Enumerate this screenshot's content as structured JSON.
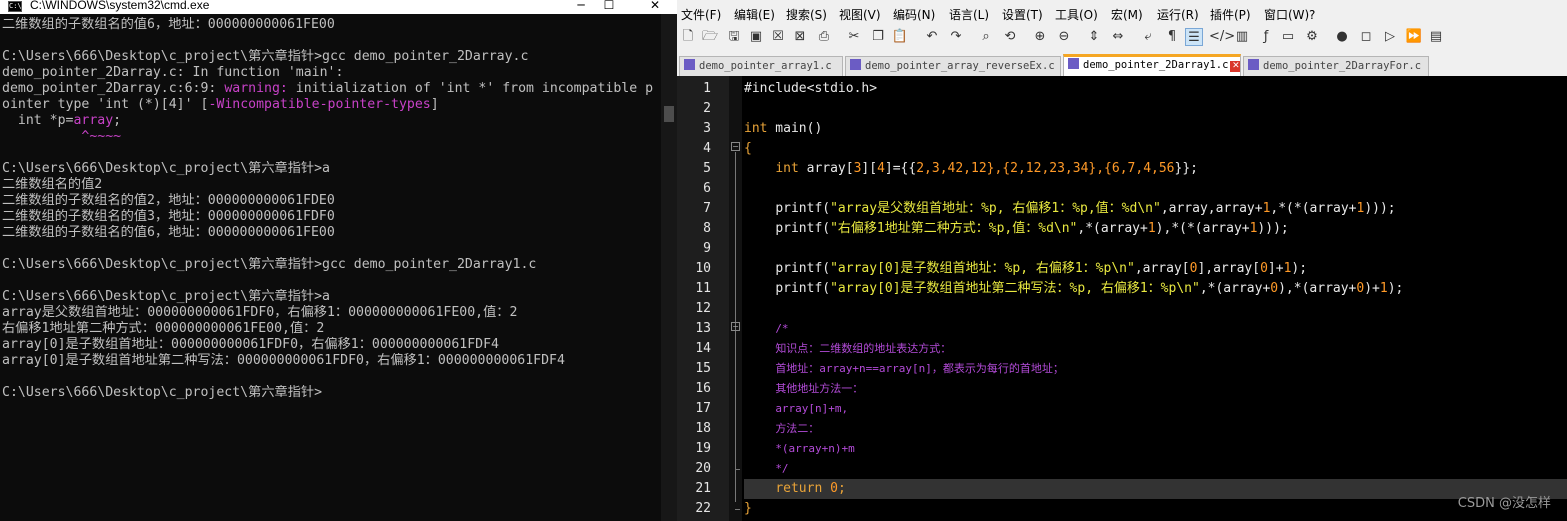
{
  "cmd": {
    "title": "C:\\WINDOWS\\system32\\cmd.exe",
    "lines": [
      {
        "text": "二维数组的子数组名的值6，地址：000000000061FE00"
      },
      {
        "text": ""
      },
      {
        "text": "C:\\Users\\666\\Desktop\\c_project\\第六章指针>gcc demo_pointer_2Darray.c"
      },
      {
        "text": "demo_pointer_2Darray.c: In function 'main':"
      },
      {
        "pre": "demo_pointer_2Darray.c:6:9: ",
        "warn": "warning:",
        "post": " initialization of 'int *' from incompatible p"
      },
      {
        "pre": "ointer type 'int (*)[4]' [",
        "warn": "-Wincompatible-pointer-types",
        "post": "]"
      },
      {
        "pre": "  int *p=",
        "warn": "array",
        "post": ";"
      },
      {
        "pre": "          ",
        "warn": "^~~~~",
        "post": ""
      },
      {
        "text": ""
      },
      {
        "text": "C:\\Users\\666\\Desktop\\c_project\\第六章指针>a"
      },
      {
        "text": "二维数组名的值2"
      },
      {
        "text": "二维数组的子数组名的值2，地址：000000000061FDE0"
      },
      {
        "text": "二维数组的子数组名的值3，地址：000000000061FDF0"
      },
      {
        "text": "二维数组的子数组名的值6，地址：000000000061FE00"
      },
      {
        "text": ""
      },
      {
        "text": "C:\\Users\\666\\Desktop\\c_project\\第六章指针>gcc demo_pointer_2Darray1.c"
      },
      {
        "text": ""
      },
      {
        "text": "C:\\Users\\666\\Desktop\\c_project\\第六章指针>a"
      },
      {
        "text": "array是父数组首地址：000000000061FDF0，右偏移1：000000000061FE00,值：2"
      },
      {
        "text": "右偏移1地址第二种方式：000000000061FE00,值：2"
      },
      {
        "text": "array[0]是子数组首地址：000000000061FDF0，右偏移1：000000000061FDF4"
      },
      {
        "text": "array[0]是子数组首地址第二种写法：000000000061FDF0，右偏移1：000000000061FDF4"
      },
      {
        "text": ""
      },
      {
        "text": "C:\\Users\\666\\Desktop\\c_project\\第六章指针>"
      }
    ]
  },
  "npp": {
    "menu": [
      "文件(F)",
      "编辑(E)",
      "搜索(S)",
      "视图(V)",
      "编码(N)",
      "语言(L)",
      "设置(T)",
      "工具(O)",
      "宏(M)",
      "运行(R)",
      "插件(P)",
      "窗口(W)",
      "?"
    ],
    "tabs": [
      "demo_pointer_array1.c",
      "demo_pointer_array_reverseEx.c",
      "demo_pointer_2Darray1.c",
      "demo_pointer_2DarrayFor.c"
    ],
    "active_tab": 2,
    "line_numbers": [
      "1",
      "2",
      "3",
      "4",
      "5",
      "6",
      "7",
      "8",
      "9",
      "10",
      "11",
      "12",
      "13",
      "14",
      "15",
      "16",
      "17",
      "18",
      "19",
      "20",
      "21",
      "22"
    ],
    "code": {
      "l1": "#include<stdio.h>",
      "l3_kw": "int",
      "l3_rest": " main()",
      "l4": "{",
      "l5_kw": "int",
      "l5_a": " array[",
      "l5_n1": "3",
      "l5_b": "][",
      "l5_n2": "4",
      "l5_c": "]={{",
      "l5_vals": "2,3,42,12},{2,12,23,34},{6,7,4,56",
      "l5_d": "}};",
      "l7_a": "printf(",
      "l7_str": "\"array是父数组首地址：%p, 右偏移1：%p,值：%d\\n\"",
      "l7_b": ",array,array+",
      "l7_n1": "1",
      "l7_c": ",*(*(array+",
      "l7_n2": "1",
      "l7_d": ")));",
      "l8_a": "printf(",
      "l8_str": "\"右偏移1地址第二种方式：%p,值：%d\\n\"",
      "l8_b": ",*(array+",
      "l8_n1": "1",
      "l8_c": "),*(*(array+",
      "l8_n2": "1",
      "l8_d": ")));",
      "l10_a": "printf(",
      "l10_str": "\"array[0]是子数组首地址：%p, 右偏移1：%p\\n\"",
      "l10_b": ",array[",
      "l10_n1": "0",
      "l10_c": "],array[",
      "l10_n2": "0",
      "l10_d": "]+",
      "l10_n3": "1",
      "l10_e": ");",
      "l11_a": "printf(",
      "l11_str": "\"array[0]是子数组首地址第二种写法：%p, 右偏移1：%p\\n\"",
      "l11_b": ",*(array+",
      "l11_n1": "0",
      "l11_c": "),*(array+",
      "l11_n2": "0",
      "l11_d": ")+",
      "l11_n3": "1",
      "l11_e": ");",
      "l13": "/*",
      "l14": "知识点：二维数组的地址表达方式：",
      "l15": "首地址：array+n==array[n]，都表示为每行的首地址；",
      "l16": "其他地址方法一：",
      "l17": "array[n]+m,",
      "l18": "方法二：",
      "l19": "*(array+n)+m",
      "l20": "*/",
      "l21_kw": "return",
      "l21_n": "0",
      "l21_end": ";",
      "l22": "}"
    },
    "watermark": "CSDN @没怎样"
  },
  "colors": {
    "keyword": "#e8a338",
    "string": "#e8e840",
    "number": "#ff9a28",
    "comment": "#b34bd8",
    "warning": "#c842c8",
    "tab_accent": "#f5a623"
  },
  "icons": [
    "new-file-icon",
    "open-icon",
    "save-icon",
    "save-all-icon",
    "close-icon",
    "close-all-icon",
    "print-icon",
    "cut-icon",
    "copy-icon",
    "paste-icon",
    "undo-icon",
    "redo-icon",
    "find-icon",
    "replace-icon",
    "zoom-in-icon",
    "zoom-out-icon",
    "sync-v-icon",
    "sync-h-icon",
    "wrap-icon",
    "show-all-chars-icon",
    "indent-guide-icon",
    "xml-icon",
    "map-icon",
    "function-list-icon",
    "monitor-icon",
    "doc-switcher-icon",
    "record-icon",
    "stop-icon",
    "play-icon",
    "play-multi-icon",
    "save-macro-icon"
  ]
}
